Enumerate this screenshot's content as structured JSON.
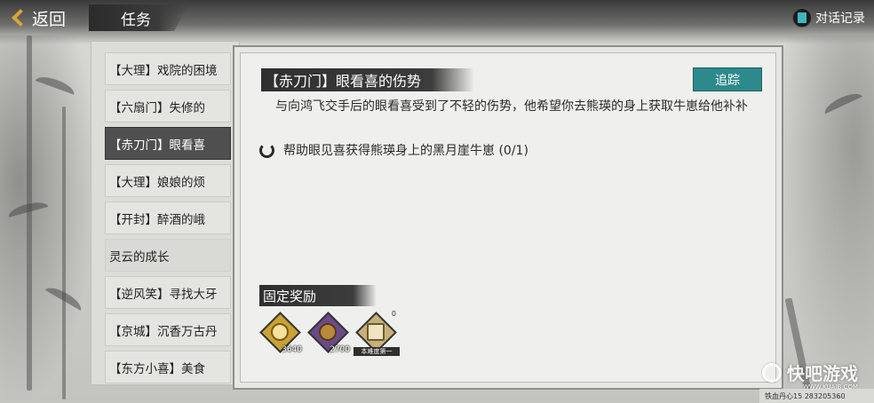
{
  "header": {
    "back_label": "返回",
    "title": "任务",
    "dialog_log_label": "对话记录"
  },
  "quest_list": {
    "items": [
      {
        "label": "【大理】戏院的困境",
        "state": "normal"
      },
      {
        "label": "【六扇门】失修的",
        "state": "normal"
      },
      {
        "label": "【赤刀门】眼看喜",
        "state": "active"
      },
      {
        "label": "【大理】娘娘的烦",
        "state": "normal"
      },
      {
        "label": "【开封】醉酒的峨",
        "state": "normal"
      },
      {
        "label": "灵云的成长",
        "state": "plain"
      },
      {
        "label": "【逆风笑】寻找大牙",
        "state": "normal"
      },
      {
        "label": "【京城】沉香万古丹",
        "state": "normal"
      },
      {
        "label": "【东方小喜】美食",
        "state": "normal"
      }
    ]
  },
  "detail": {
    "title": "【赤刀门】眼看喜的伤势",
    "track_label": "追踪",
    "description": "与向鸿飞交手后的眼看喜受到了不轻的伤势，他希望你去熊瑛的身上获取牛崽给他补补",
    "objective": "帮助眼见喜获得熊瑛身上的黑月崖牛崽 (0/1)",
    "rewards_title": "固定奖励",
    "rewards": [
      {
        "icon": "gold-coin-icon",
        "count": "3640",
        "color": "#caa235"
      },
      {
        "icon": "copper-coin-icon",
        "count": "2700",
        "color": "#6b4a8a"
      },
      {
        "icon": "manual-book-icon",
        "corner": "0",
        "tag": "本难度第一",
        "color": "#c9b07a"
      }
    ]
  },
  "watermark": {
    "name": "快吧游戏",
    "url": "WWW.KUAIB.COM",
    "footer": "铁血丹心15  283205360"
  }
}
